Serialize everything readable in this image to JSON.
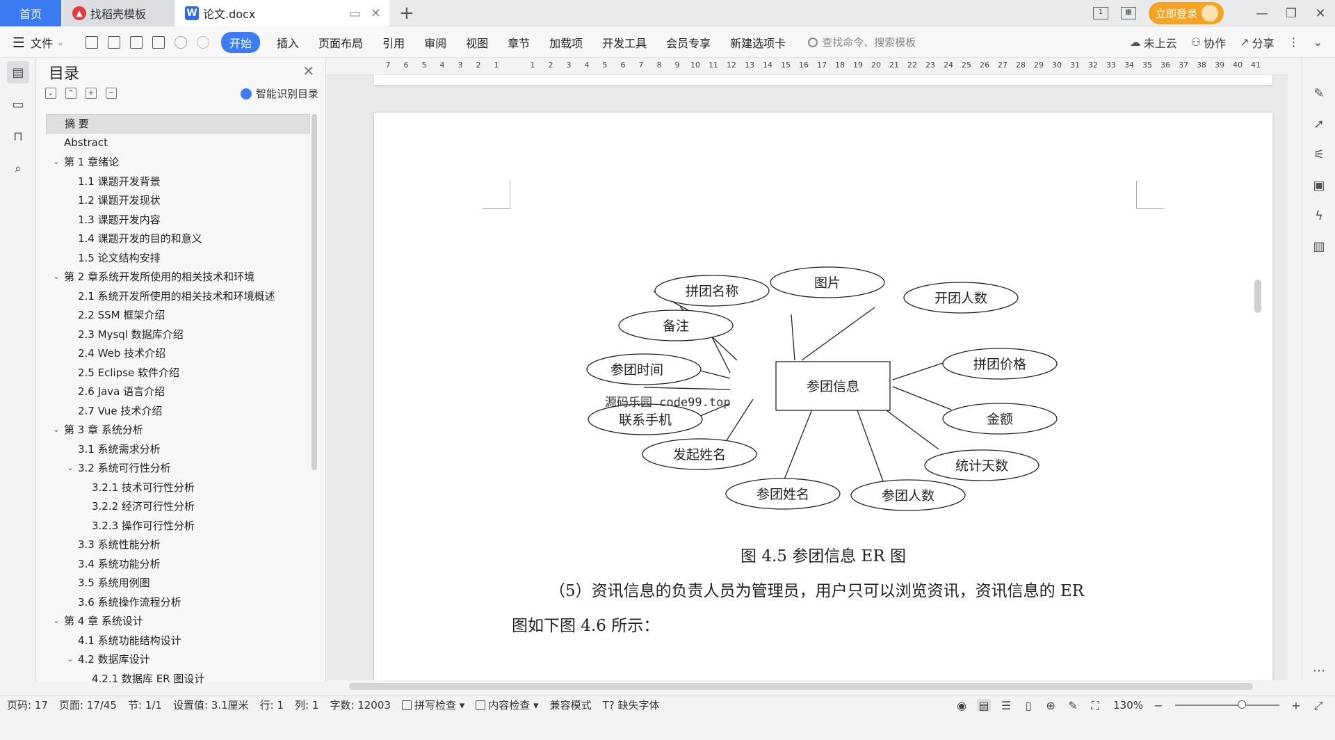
{
  "tabs": {
    "home": "首页",
    "template": "找稻壳模板",
    "document": "论文.docx",
    "new_tab": "+"
  },
  "window": {
    "login": "立即登录"
  },
  "menu": {
    "file": "文件",
    "items": [
      "开始",
      "插入",
      "页面布局",
      "引用",
      "审阅",
      "视图",
      "章节",
      "加载项",
      "开发工具",
      "会员专享",
      "新建选项卡"
    ],
    "search_placeholder": "查找命令、搜索模板",
    "cloud": "未上云",
    "collab": "协作",
    "share": "分享"
  },
  "outline": {
    "title": "目录",
    "smart": "智能识别目录",
    "items": [
      {
        "label": "摘  要",
        "level": 1,
        "caret": false,
        "selected": true
      },
      {
        "label": "Abstract",
        "level": 1,
        "caret": false
      },
      {
        "label": "第 1 章绪论",
        "level": 1,
        "caret": true
      },
      {
        "label": "1.1 课题开发背景",
        "level": 2
      },
      {
        "label": "1.2 课题开发现状",
        "level": 2
      },
      {
        "label": "1.3 课题开发内容",
        "level": 2
      },
      {
        "label": "1.4 课题开发的目的和意义",
        "level": 2
      },
      {
        "label": "1.5 论文结构安排",
        "level": 2
      },
      {
        "label": "第 2 章系统开发所使用的相关技术和环境",
        "level": 1,
        "caret": true
      },
      {
        "label": "2.1 系统开发所使用的相关技术和环境概述",
        "level": 2
      },
      {
        "label": "2.2 SSM 框架介绍",
        "level": 2
      },
      {
        "label": "2.3 Mysql 数据库介绍",
        "level": 2
      },
      {
        "label": "2.4 Web 技术介绍",
        "level": 2
      },
      {
        "label": "2.5 Eclipse 软件介绍",
        "level": 2
      },
      {
        "label": "2.6 Java 语言介绍",
        "level": 2
      },
      {
        "label": "2.7 Vue 技术介绍",
        "level": 2
      },
      {
        "label": "第 3 章  系统分析",
        "level": 1,
        "caret": true
      },
      {
        "label": "3.1 系统需求分析",
        "level": 2
      },
      {
        "label": "3.2 系统可行性分析",
        "level": 2,
        "caret": true
      },
      {
        "label": "3.2.1 技术可行性分析",
        "level": 3
      },
      {
        "label": "3.2.2 经济可行性分析",
        "level": 3
      },
      {
        "label": "3.2.3 操作可行性分析",
        "level": 3
      },
      {
        "label": "3.3 系统性能分析",
        "level": 2
      },
      {
        "label": "3.4  系统功能分析",
        "level": 2
      },
      {
        "label": "3.5 系统用例图",
        "level": 2
      },
      {
        "label": "3.6 系统操作流程分析",
        "level": 2
      },
      {
        "label": "第 4 章  系统设计",
        "level": 1,
        "caret": true
      },
      {
        "label": "4.1 系统功能结构设计",
        "level": 2
      },
      {
        "label": "4.2 数据库设计",
        "level": 2,
        "caret": true
      },
      {
        "label": "4.2.1 数据库 ER 图设计",
        "level": 3
      }
    ]
  },
  "ruler": {
    "ticks": [
      "7",
      "6",
      "5",
      "4",
      "3",
      "2",
      "1",
      "",
      "1",
      "2",
      "3",
      "4",
      "5",
      "6",
      "7",
      "8",
      "9",
      "10",
      "11",
      "12",
      "13",
      "14",
      "15",
      "16",
      "17",
      "18",
      "19",
      "20",
      "21",
      "22",
      "23",
      "24",
      "25",
      "26",
      "27",
      "28",
      "29",
      "30",
      "31",
      "32",
      "33",
      "34",
      "35",
      "36",
      "37",
      "38",
      "39",
      "40",
      "41"
    ]
  },
  "document": {
    "er_diagram": {
      "entity": "参团信息",
      "attributes": [
        "拼团名称",
        "图片",
        "开团人数",
        "备注",
        "参团时间",
        "拼团价格",
        "联系手机",
        "金额",
        "发起姓名",
        "统计天数",
        "参团姓名",
        "参团人数"
      ]
    },
    "watermark": "源码乐园 code99.top",
    "figure_caption": "图 4.5 参团信息 ER 图",
    "paragraph_line1": "（5）资讯信息的负责人员为管理员，用户只可以浏览资讯，资讯信息的 ER",
    "paragraph_line2": "图如下图 4.6 所示："
  },
  "status": {
    "page_code": "页码: 17",
    "page": "页面: 17/45",
    "section": "节: 1/1",
    "setting": "设置值: 3.1厘米",
    "row": "行: 1",
    "col": "列: 1",
    "words": "字数: 12003",
    "spell": "拼写检查",
    "content": "内容检查",
    "compat": "兼容模式",
    "missing_font": "缺失字体",
    "zoom": "130%"
  }
}
